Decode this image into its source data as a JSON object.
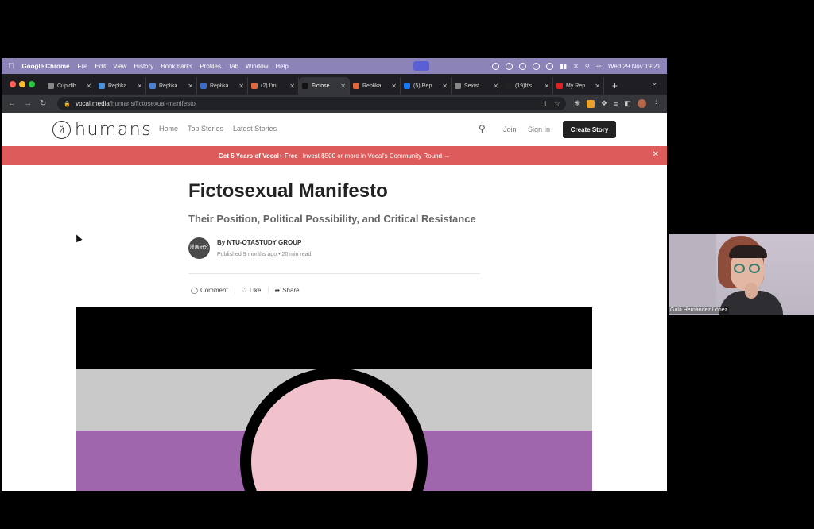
{
  "menubar": {
    "app": "Google Chrome",
    "items": [
      "File",
      "Edit",
      "View",
      "History",
      "Bookmarks",
      "Profiles",
      "Tab",
      "Window",
      "Help"
    ],
    "clock": "Wed 29 Nov  19:21"
  },
  "tabs": [
    {
      "label": "Cupidlb",
      "color": "#888888"
    },
    {
      "label": "Replika",
      "color": "#4a90d9"
    },
    {
      "label": "Replika",
      "color": "#4a7fd1"
    },
    {
      "label": "Replika",
      "color": "#3b6ac8"
    },
    {
      "label": "(2) I'm",
      "color": "#e06a3b"
    },
    {
      "label": "Fictose",
      "color": "#111111",
      "active": true
    },
    {
      "label": "Replika",
      "color": "#e06a3b"
    },
    {
      "label": "(5) Rep",
      "color": "#1877f2"
    },
    {
      "label": "Sexist",
      "color": "#888888"
    },
    {
      "label": "(19)It's",
      "color": "#222222"
    },
    {
      "label": "My Rep",
      "color": "#e02020"
    }
  ],
  "address": {
    "domain": "vocal.media",
    "path": "/humans/fictosexual-manifesto"
  },
  "site": {
    "logo_text": "humans",
    "nav": [
      "Home",
      "Top Stories",
      "Latest Stories"
    ],
    "join": "Join",
    "sign_in": "Sign In",
    "create_story": "Create Story"
  },
  "promo": {
    "bold": "Get 5 Years of Vocal+ Free",
    "text": "Invest $500 or more in Vocal's Community Round →"
  },
  "article": {
    "title": "Fictosexual Manifesto",
    "subtitle": "Their Position, Political Possibility, and Critical Resistance",
    "byline": "By NTU-OTASTUDY GROUP",
    "meta": "Published 9 months ago • 20 min read",
    "avatar_text": "漫画研究",
    "actions": {
      "comment": "Comment",
      "like": "Like",
      "share": "Share"
    }
  },
  "webcam": {
    "name": "Gala Hernández López"
  },
  "colors": {
    "promo": "#dd5b5b",
    "flag_purple": "#9f66ad",
    "flag_grey": "#c9c9c9",
    "flag_pink": "#f1c2cb",
    "menubar": "#8c83b8"
  }
}
